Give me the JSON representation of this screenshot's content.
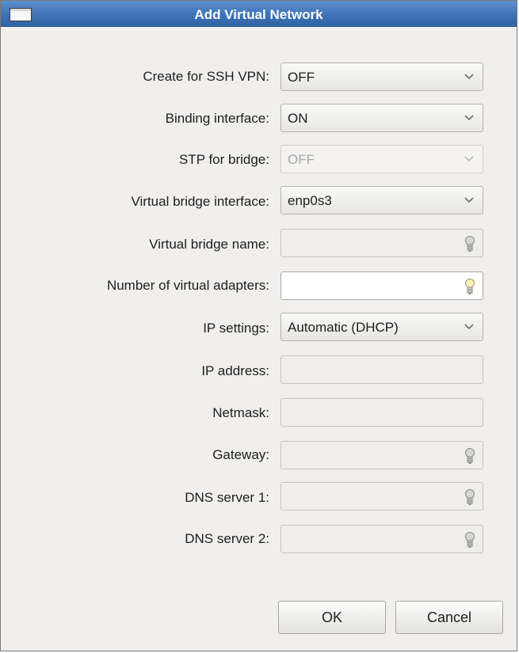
{
  "window": {
    "title": "Add Virtual Network"
  },
  "fields": {
    "ssh_vpn": {
      "label": "Create for SSH VPN:",
      "value": "OFF"
    },
    "binding": {
      "label": "Binding interface:",
      "value": "ON"
    },
    "stp": {
      "label": "STP for bridge:",
      "value": "OFF"
    },
    "bridge_if": {
      "label": "Virtual bridge interface:",
      "value": "enp0s3"
    },
    "bridge_name": {
      "label": "Virtual bridge name:",
      "value": ""
    },
    "num_adapters": {
      "label": "Number of virtual adapters:",
      "value": ""
    },
    "ip_settings": {
      "label": "IP settings:",
      "value": "Automatic (DHCP)"
    },
    "ip_address": {
      "label": "IP address:",
      "value": ""
    },
    "netmask": {
      "label": "Netmask:",
      "value": ""
    },
    "gateway": {
      "label": "Gateway:",
      "value": ""
    },
    "dns1": {
      "label": "DNS server 1:",
      "value": ""
    },
    "dns2": {
      "label": "DNS server 2:",
      "value": ""
    }
  },
  "buttons": {
    "ok": "OK",
    "cancel": "Cancel"
  },
  "icons": {
    "dropdown": "chevron-down-icon",
    "hint": "lightbulb-icon"
  }
}
